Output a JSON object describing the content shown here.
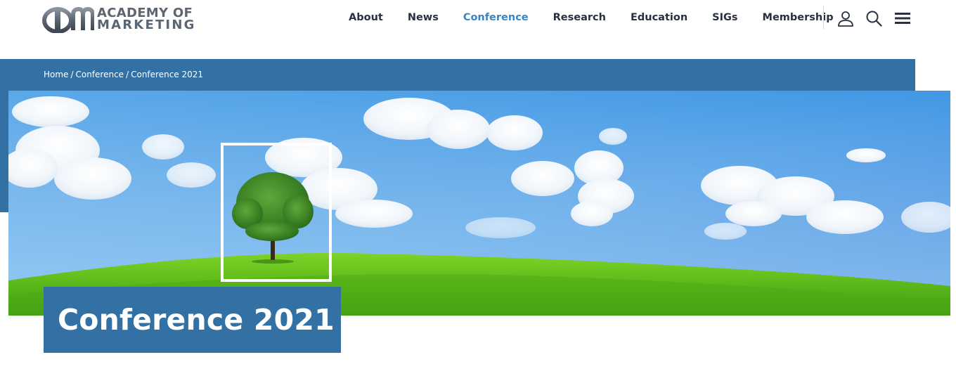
{
  "brand": {
    "line1": "ACADEMY OF",
    "line2": "MARKETING",
    "color": "#5c6673"
  },
  "nav": {
    "items": [
      {
        "label": "About",
        "active": false
      },
      {
        "label": "News",
        "active": false
      },
      {
        "label": "Conference",
        "active": true
      },
      {
        "label": "Research",
        "active": false
      },
      {
        "label": "Education",
        "active": false
      },
      {
        "label": "SIGs",
        "active": false
      },
      {
        "label": "Membership",
        "active": false
      }
    ],
    "active_color": "#3b84c4",
    "text_color": "#283140"
  },
  "header_icons": [
    "user-icon",
    "search-icon",
    "hamburger-menu-icon"
  ],
  "breadcrumb": {
    "items": [
      "Home",
      "Conference",
      "Conference 2021"
    ],
    "separator": "/"
  },
  "hero": {
    "title": "Conference 2021",
    "image": "tree-on-green-hill-under-blue-sky",
    "accent_color": "#3370a4"
  }
}
